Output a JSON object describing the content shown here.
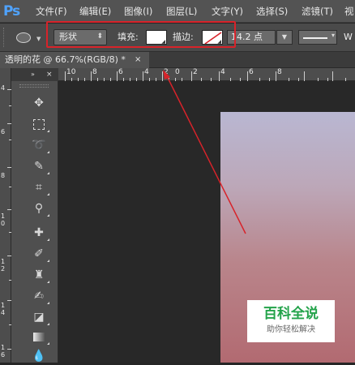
{
  "app_logo": "Ps",
  "menu": [
    "文件(F)",
    "编辑(E)",
    "图像(I)",
    "图层(L)",
    "文字(Y)",
    "选择(S)",
    "滤镜(T)",
    "视"
  ],
  "options_bar": {
    "mode": "形状",
    "fill_label": "填充:",
    "stroke_label": "描边:",
    "stroke_width": "14.2 点",
    "overflow_label": "W"
  },
  "document_tab": {
    "title": "透明的花 @ 66.7%(RGB/8) *",
    "close": "×"
  },
  "panel_controls": {
    "collapse": "»",
    "close": "×"
  },
  "ruler_top": [
    "4",
    "2",
    "0",
    "10",
    "8",
    "6",
    "4",
    "2",
    "0",
    "2",
    "4",
    "6",
    "8"
  ],
  "ruler_left": [
    "4",
    "6",
    "8",
    "1 0",
    "1 2",
    "1 4",
    "1 6"
  ],
  "tools": [
    "move-tool",
    "marquee-tool",
    "lasso-tool",
    "quick-select-tool",
    "crop-tool",
    "eyedropper-tool",
    "healing-brush-tool",
    "brush-tool",
    "clone-stamp-tool",
    "history-brush-tool",
    "eraser-tool",
    "gradient-tool",
    "blur-tool"
  ],
  "watermark": {
    "title": "百科全说",
    "subtitle": "助你轻松解决"
  },
  "colors": {
    "accent_red": "#d8232a",
    "ps_blue": "#4fa3ff",
    "watermark_green": "#23a34a"
  }
}
